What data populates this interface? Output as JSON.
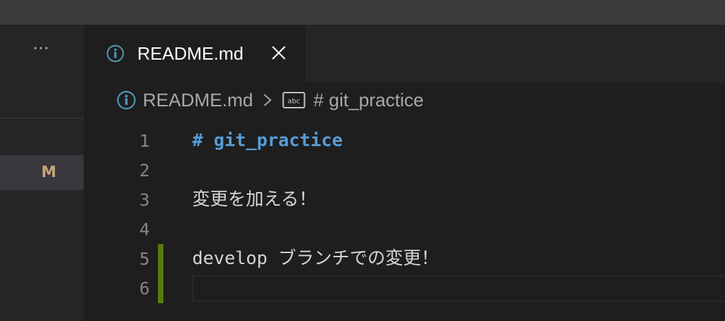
{
  "sidebar": {
    "more_label": "···",
    "file_badge": "M"
  },
  "tab": {
    "label": "README.md"
  },
  "breadcrumb": {
    "file": "README.md",
    "symbol": "# git_practice"
  },
  "code": {
    "lines": [
      {
        "number": "1",
        "text": "# git_practice"
      },
      {
        "number": "2",
        "text": ""
      },
      {
        "number": "3",
        "text": "変更を加える！"
      },
      {
        "number": "4",
        "text": ""
      },
      {
        "number": "5",
        "text": "develop ブランチでの変更！"
      },
      {
        "number": "6",
        "text": ""
      }
    ]
  },
  "colors": {
    "info_icon": "#519aba",
    "heading": "#569cd6",
    "modified_badge": "#c5a77b",
    "added_gutter": "#587c0c"
  }
}
